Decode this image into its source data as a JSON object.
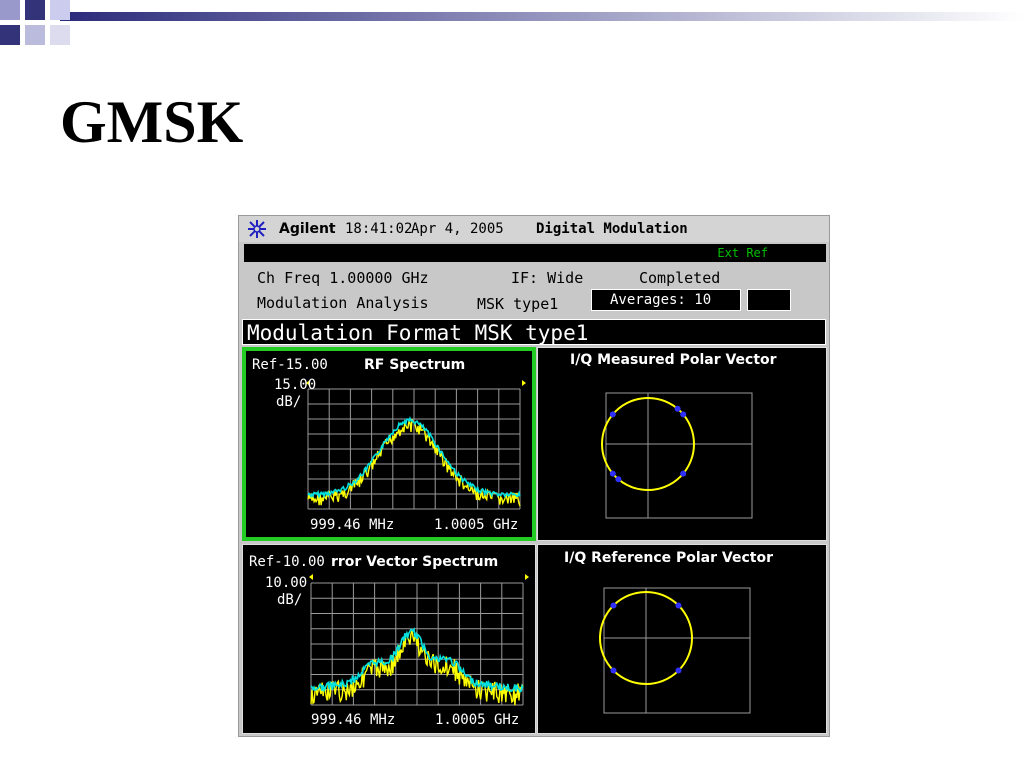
{
  "slide": {
    "title": "GMSK"
  },
  "instrument": {
    "brand": "Agilent",
    "time": "18:41:02",
    "date": "Apr 4, 2005",
    "mode": "Digital Modulation",
    "ext_ref": "Ext Ref",
    "ch_freq": "Ch Freq 1.00000 GHz",
    "if": "IF: Wide",
    "status": "Completed",
    "analysis": "Modulation Analysis",
    "format_short": "MSK type1",
    "averages": "Averages: 10",
    "banner": "Modulation Format MSK type1"
  },
  "panels": {
    "rf": {
      "ref": "Ref-15.00",
      "title": "RF Spectrum",
      "scale": "15.00",
      "unit": "dB/",
      "x_start": "999.46 MHz",
      "x_end": "1.0005 GHz"
    },
    "iq_meas": {
      "title": "I/Q Measured Polar Vector"
    },
    "evs": {
      "ref": "Ref-10.00",
      "title": "rror Vector Spectrum",
      "scale": "10.00",
      "unit": "dB/",
      "x_start": "999.46 MHz",
      "x_end": "1.0005 GHz"
    },
    "iq_ref": {
      "title": "I/Q Reference Polar Vector"
    }
  },
  "colors": {
    "trace_yellow": "#ffff00",
    "trace_cyan": "#00e0e0",
    "active_border": "#22cc22",
    "symbol_blue": "#3030ff"
  }
}
